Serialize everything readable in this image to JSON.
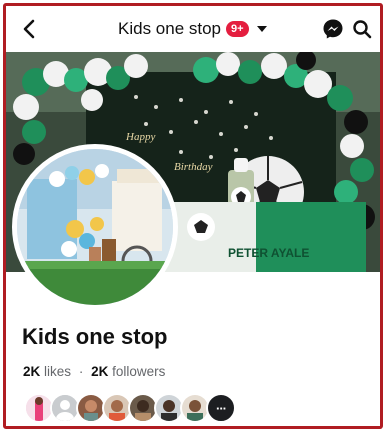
{
  "header": {
    "title": "Kids one stop",
    "notification_badge": "9+",
    "icons": [
      "back-arrow-icon",
      "messenger-icon",
      "search-icon",
      "dropdown-caret-icon"
    ]
  },
  "cover": {
    "banner_text_1": "Happy",
    "banner_text_2": "Birthday",
    "sign_text": "PETER AYALE"
  },
  "profile": {
    "name": "Kids one stop",
    "likes_count": "2K",
    "likes_label": "likes",
    "separator": "·",
    "followers_count": "2K",
    "followers_label": "followers"
  },
  "friends": {
    "avatars": [
      "friend-1",
      "friend-2",
      "friend-3",
      "friend-4",
      "friend-5",
      "friend-6",
      "friend-7"
    ],
    "more_label": "···"
  },
  "colors": {
    "frame_border": "#b01c22",
    "badge": "#e41e3f",
    "balloon_green": "#1f8f5a",
    "balloon_white": "#f2f2f2"
  }
}
